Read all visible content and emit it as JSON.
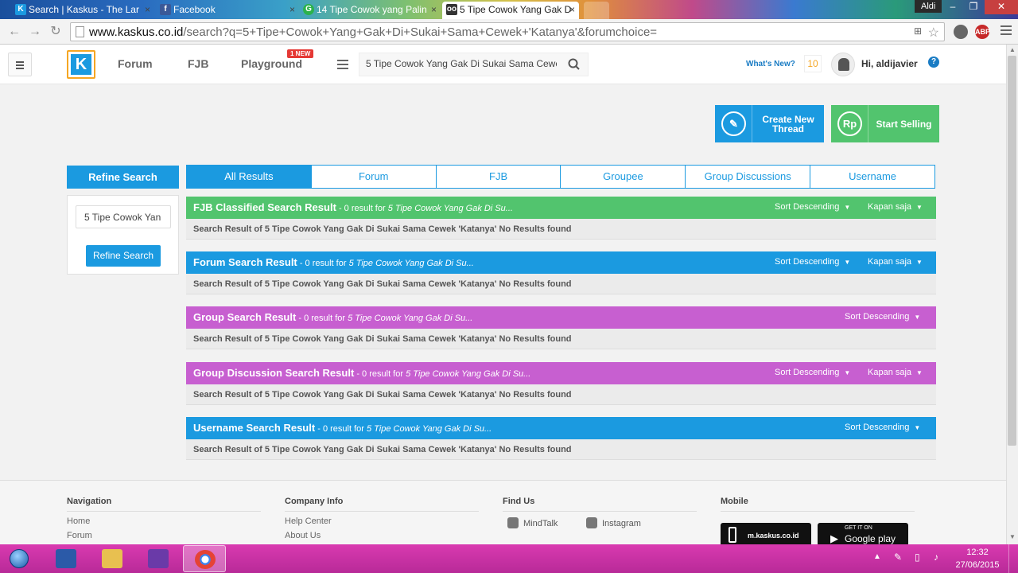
{
  "browser": {
    "tabs": [
      {
        "title": "Search | Kaskus - The Lar",
        "favicon": "kaskus-icon",
        "active": false
      },
      {
        "title": "Facebook",
        "favicon": "facebook-icon",
        "active": false
      },
      {
        "title": "14 Tipe Cowok yang Palin",
        "favicon": "g-icon",
        "active": false
      },
      {
        "title": "5 Tipe Cowok Yang Gak D",
        "favicon": "glasses-icon",
        "active": true
      }
    ],
    "profile_name": "Aldi",
    "url_host": "www.kaskus.co.id",
    "url_rest": "/search?q=5+Tipe+Cowok+Yang+Gak+Di+Sukai+Sama+Cewek+'Katanya'&forumchoice=",
    "abp_badge": "ABP",
    "abp_count": "4"
  },
  "header": {
    "nav": [
      {
        "label": "Forum"
      },
      {
        "label": "FJB"
      },
      {
        "label": "Playground"
      }
    ],
    "new_badge": "1 NEW",
    "search_value": "5 Tipe Cowok Yang Gak Di Sukai Sama Cewek",
    "whats_new": "What's New?",
    "notif_count": "10",
    "greeting": "Hi, aldijavier",
    "help": "?"
  },
  "actions": {
    "create_label_1": "Create New",
    "create_label_2": "Thread",
    "sell_label": "Start Selling",
    "sell_icon_text": "Rp"
  },
  "refine": {
    "title": "Refine Search",
    "input_value": "5 Tipe Cowok Yan",
    "button": "Refine Search"
  },
  "tabs": [
    {
      "label": "All Results",
      "active": true
    },
    {
      "label": "Forum"
    },
    {
      "label": "FJB"
    },
    {
      "label": "Groupee"
    },
    {
      "label": "Group Discussions"
    },
    {
      "label": "Username"
    }
  ],
  "results": [
    {
      "title": "FJB Classified Search Result",
      "count": " - 0 result for ",
      "query": "5 Tipe Cowok Yang Gak Di Su...",
      "sort": "Sort Descending",
      "time": "Kapan saja",
      "color": "#52c46e",
      "message": "Search Result of 5 Tipe Cowok Yang Gak Di Sukai Sama Cewek 'Katanya' No Results found"
    },
    {
      "title": "Forum Search Result",
      "count": " - 0 result for ",
      "query": "5 Tipe Cowok Yang Gak Di Su...",
      "sort": "Sort Descending",
      "time": "Kapan saja",
      "color": "#1b9ae0",
      "message": "Search Result of 5 Tipe Cowok Yang Gak Di Sukai Sama Cewek 'Katanya' No Results found"
    },
    {
      "title": "Group Search Result",
      "count": " - 0 result for ",
      "query": "5 Tipe Cowok Yang Gak Di Su...",
      "sort": "Sort Descending",
      "time": "",
      "color": "#c75fd0",
      "message": "Search Result of 5 Tipe Cowok Yang Gak Di Sukai Sama Cewek 'Katanya' No Results found"
    },
    {
      "title": "Group Discussion Search Result",
      "count": " - 0 result for ",
      "query": "5 Tipe Cowok Yang Gak Di Su...",
      "sort": "Sort Descending",
      "time": "Kapan saja",
      "color": "#c75fd0",
      "message": "Search Result of 5 Tipe Cowok Yang Gak Di Sukai Sama Cewek 'Katanya' No Results found"
    },
    {
      "title": "Username Search Result",
      "count": " - 0 result for ",
      "query": "5 Tipe Cowok Yang Gak Di Su...",
      "sort": "Sort Descending",
      "time": "",
      "color": "#1b9ae0",
      "message": "Search Result of 5 Tipe Cowok Yang Gak Di Sukai Sama Cewek 'Katanya' No Results found"
    }
  ],
  "footer": {
    "navigation": {
      "title": "Navigation",
      "links": [
        "Home",
        "Forum"
      ]
    },
    "company": {
      "title": "Company Info",
      "links": [
        "Help Center",
        "About Us"
      ]
    },
    "findus": {
      "title": "Find Us",
      "links": [
        "MindTalk",
        "Instagram"
      ]
    },
    "mobile": {
      "title": "Mobile",
      "site": "m.kaskus.co.id",
      "store_top": "GET IT ON",
      "store": "Google play"
    }
  },
  "taskbar": {
    "time": "12:32",
    "date": "27/06/2015"
  }
}
